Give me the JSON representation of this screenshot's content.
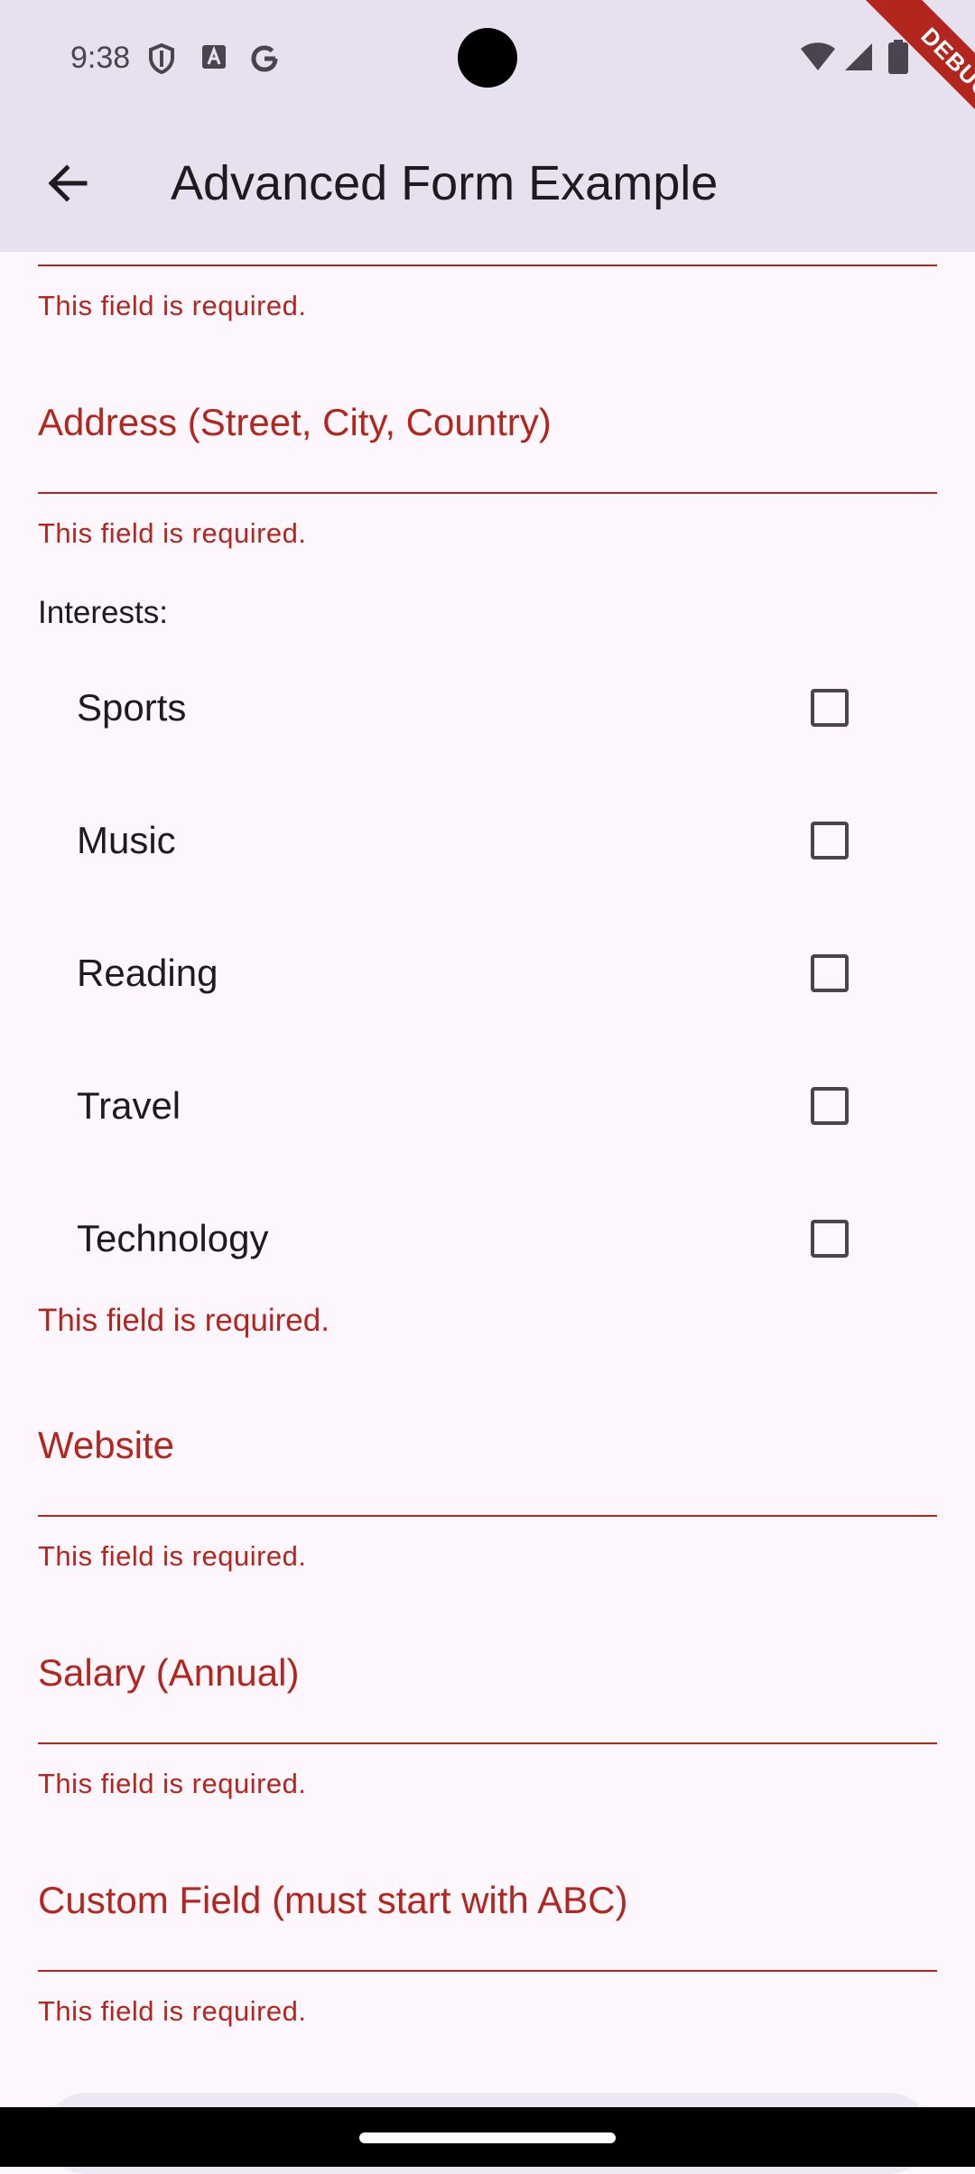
{
  "status_bar": {
    "time": "9:38",
    "icons_left": [
      "shield-icon",
      "font-icon",
      "google-icon"
    ],
    "icons_right": [
      "wifi-icon",
      "signal-icon",
      "battery-icon"
    ]
  },
  "app_bar": {
    "back_icon": "arrow-back-icon",
    "title": "Advanced Form Example"
  },
  "debug_banner": "DEBUG",
  "form": {
    "prev_field_error": "This field is required.",
    "address": {
      "label": "Address (Street, City, Country)",
      "error": "This field is required."
    },
    "interests": {
      "label": "Interests:",
      "options": [
        {
          "label": "Sports",
          "checked": false
        },
        {
          "label": "Music",
          "checked": false
        },
        {
          "label": "Reading",
          "checked": false
        },
        {
          "label": "Travel",
          "checked": false
        },
        {
          "label": "Technology",
          "checked": false
        }
      ],
      "error": "This field is required."
    },
    "website": {
      "label": "Website",
      "error": "This field is required."
    },
    "salary": {
      "label": "Salary (Annual)",
      "error": "This field is required."
    },
    "custom": {
      "label": "Custom Field (must start with ABC)",
      "error": "This field is required."
    }
  },
  "colors": {
    "error": "#B3261E",
    "app_bar_bg": "#E7E0EE",
    "page_bg": "#FDF7FD"
  }
}
